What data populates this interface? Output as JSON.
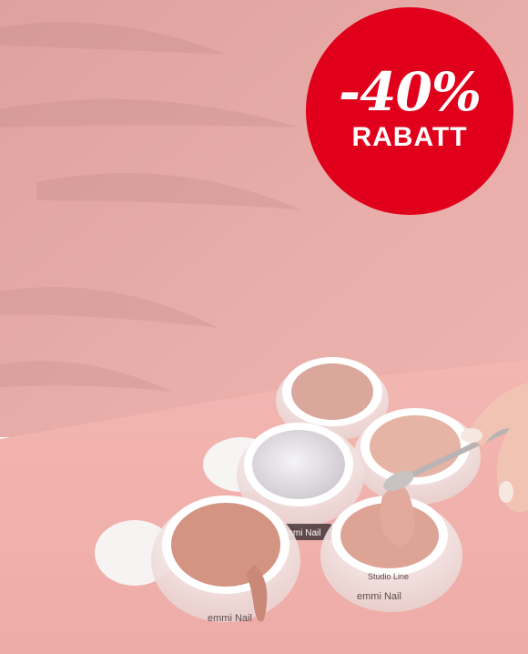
{
  "promo": {
    "discount_text": "-40%",
    "discount_word": "RABATT"
  },
  "products": {
    "brand_label": "emmi Nail",
    "jar_label": "Studio Line"
  },
  "colors": {
    "badge_red": "#e0001b",
    "wall_pink": "#e7aaa6",
    "table_pink": "#f1b2ae",
    "gel_nude": "#d59a8d",
    "gel_light": "#e5b4a4",
    "gel_glitter": "#e9e6ea"
  }
}
